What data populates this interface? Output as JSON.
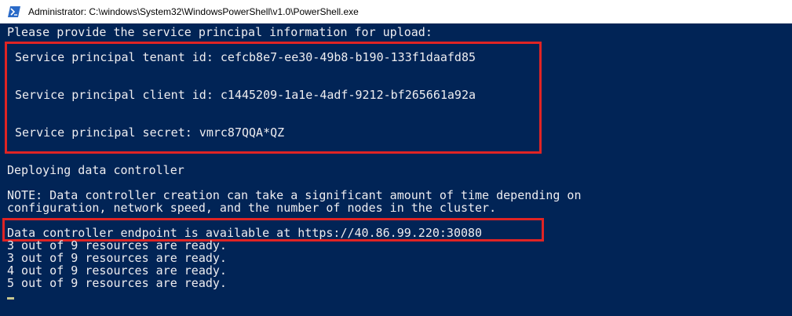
{
  "window": {
    "title": "Administrator: C:\\windows\\System32\\WindowsPowerShell\\v1.0\\PowerShell.exe",
    "icon": "powershell-icon"
  },
  "colors": {
    "console_bg": "#012456",
    "console_fg": "#eeedf0",
    "highlight": "#e02424"
  },
  "console": {
    "prompt_header": "Please provide the service principal information for upload:",
    "tenant_line": "Service principal tenant id: cefcb8e7-ee30-49b8-b190-133f1daafd85",
    "client_line": "Service principal client id: c1445209-1a1e-4adf-9212-bf265661a92a",
    "secret_line": "Service principal secret: vmrc87QQA*QZ",
    "deploying": "Deploying data controller",
    "note_line1": "NOTE: Data controller creation can take a significant amount of time depending on",
    "note_line2": "configuration, network speed, and the number of nodes in the cluster.",
    "endpoint_line": "Data controller endpoint is available at https://40.86.99.220:30080",
    "progress": [
      "3 out of 9 resources are ready.",
      "3 out of 9 resources are ready.",
      "4 out of 9 resources are ready.",
      "5 out of 9 resources are ready."
    ]
  }
}
